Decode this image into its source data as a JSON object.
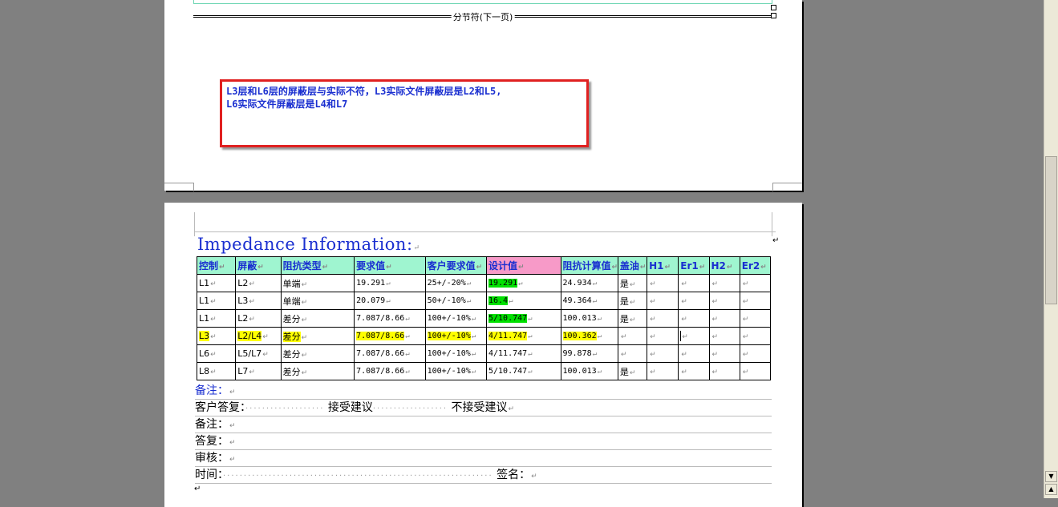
{
  "page1": {
    "section_break": "分节符(下一页)",
    "comment_lines": [
      "L3层和L6层的屏蔽层与实际不符，L3实际文件屏蔽层是L2和L5,",
      "L6实际文件屏蔽层是L4和L7"
    ],
    "colors": {
      "comment_border": "#e02020",
      "comment_text": "#1a2fd0"
    }
  },
  "page2": {
    "title": "Impedance Information:",
    "table": {
      "headers": [
        "控制",
        "屏蔽",
        "阻抗类型",
        "要求值",
        "客户要求值",
        "设计值",
        "阻抗计算值",
        "盖油",
        "H1",
        "Er1",
        "H2",
        "Er2"
      ],
      "rows": [
        {
          "cells": [
            "L1",
            "L2",
            "单端",
            "19.291",
            "25+/-20%",
            "19.291",
            "24.934",
            "是",
            "",
            "",
            "",
            ""
          ]
        },
        {
          "cells": [
            "L1",
            "L3",
            "单端",
            "20.079",
            "50+/-10%",
            "16.4",
            "49.364",
            "是",
            "",
            "",
            "",
            ""
          ]
        },
        {
          "cells": [
            "L1",
            "L2",
            "差分",
            "7.087/8.66",
            "100+/-10%",
            "5/10.747",
            "100.013",
            "是",
            "",
            "",
            "",
            ""
          ]
        },
        {
          "cells": [
            "L3",
            "L2/L4",
            "差分",
            "7.087/8.66",
            "100+/-10%",
            "4/11.747",
            "100.362",
            "",
            "",
            "",
            "",
            ""
          ]
        },
        {
          "cells": [
            "L6",
            "L5/L7",
            "差分",
            "7.087/8.66",
            "100+/-10%",
            "4/11.747",
            "99.878",
            "",
            "",
            "",
            "",
            ""
          ]
        },
        {
          "cells": [
            "L8",
            "L7",
            "差分",
            "7.087/8.66",
            "100+/-10%",
            "5/10.747",
            "100.013",
            "是",
            "",
            "",
            "",
            ""
          ]
        }
      ],
      "colors": {
        "header_bg": "#9ff5d0",
        "design_header_bg": "#f79ac8",
        "highlight_yellow": "#ffff00",
        "highlight_green": "#00e000"
      }
    },
    "notes": {
      "remark1": "备注：",
      "customer_reply": "客户答复：",
      "accept": "接受建议",
      "reject": "不接受建议",
      "remark2": "备注：",
      "reply": "答复：",
      "review": "审核：",
      "time": "时间：",
      "sign": "签名："
    }
  }
}
